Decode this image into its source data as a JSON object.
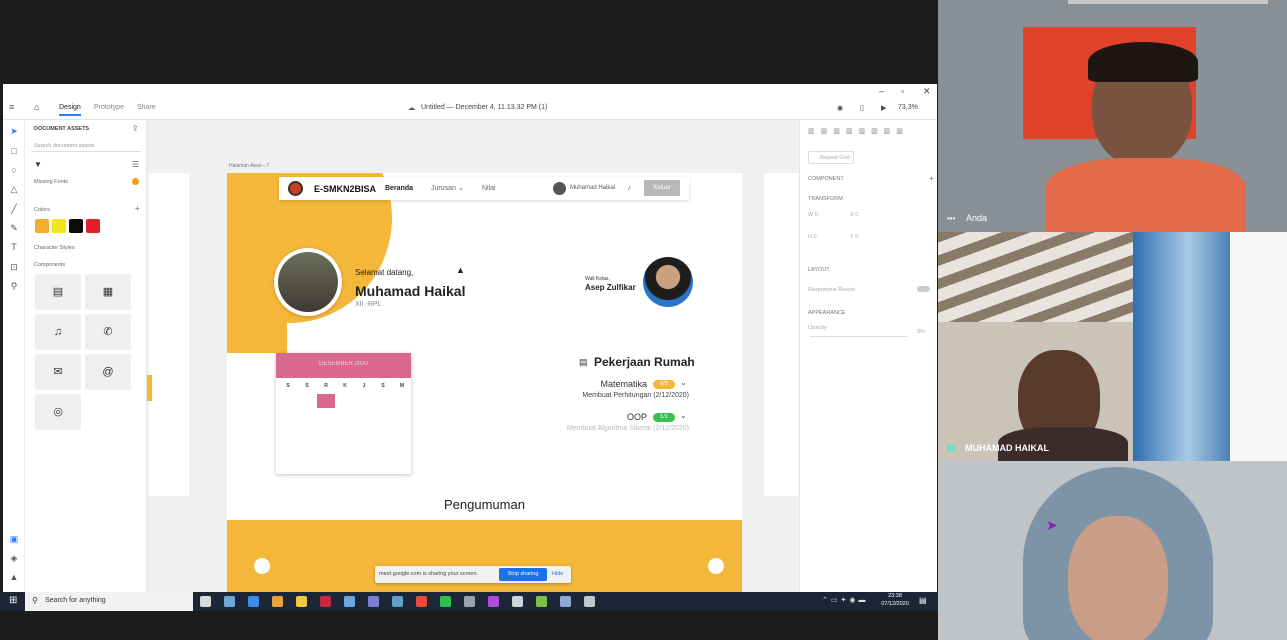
{
  "window": {
    "doc_title": "Untitled — December 4, 11.13.32 PM (1)",
    "zoom": "73,3%"
  },
  "menu": {
    "tabs": [
      "Design",
      "Prototype",
      "Share"
    ]
  },
  "assets": {
    "header": "DOCUMENT ASSETS",
    "search_placeholder": "Search document assets",
    "missing_fonts": "Missing Fonts",
    "colors_label": "Colors",
    "colors": [
      "#f2ad2e",
      "#f3e61f",
      "#0b0b0b",
      "#e21f2b"
    ],
    "char_styles": "Character Styles",
    "components": "Components"
  },
  "artboard": {
    "label": "Halaman Awal – 7",
    "brand": "E-SMKN2BISA",
    "nav": [
      "Beranda",
      "Jurusan",
      "Nilai"
    ],
    "user_name": "Muhamad Haikal",
    "logout": "Keluar",
    "greeting": "Selamat datang,",
    "student_name": "Muhamad Haikal",
    "student_class": "XII -RPL",
    "wali_label": "Wali Kelas,",
    "wali_name": "Asep Zulfikar",
    "calendar_month": "DESEMBER 2020",
    "calendar_days": [
      "S",
      "S",
      "R",
      "K",
      "J",
      "S",
      "M"
    ],
    "homework_title": "Pekerjaan Rumah",
    "homework": [
      {
        "subject": "Matematika",
        "count": "0/3",
        "task": "Membuat Perhitungan (2/12/2020)",
        "color": "#f5b73a"
      },
      {
        "subject": "OOP",
        "count": "1/1",
        "task": "Membuat Algoritma Siberat (2/12/2020)",
        "color": "#38c152"
      }
    ],
    "announcement_title": "Pengumuman"
  },
  "props": {
    "repeat_grid": "Repeat Grid",
    "component": "COMPONENT",
    "transform": "TRANSFORM",
    "layout": "LAYOUT",
    "responsive": "Responsive Resize",
    "appearance": "APPEARANCE",
    "opacity": "Opacity",
    "opacity_value": "0%"
  },
  "sharing": {
    "text": "meet.google.com is sharing your screen.",
    "stop": "Stop sharing",
    "hide": "Hide"
  },
  "taskbar": {
    "search": "Search for anything",
    "time": "23:38",
    "date": "07/12/2020"
  },
  "participants": [
    {
      "name": "Anda"
    },
    {
      "name": "MUHAMAD HAIKAL"
    },
    {
      "name": ""
    }
  ]
}
